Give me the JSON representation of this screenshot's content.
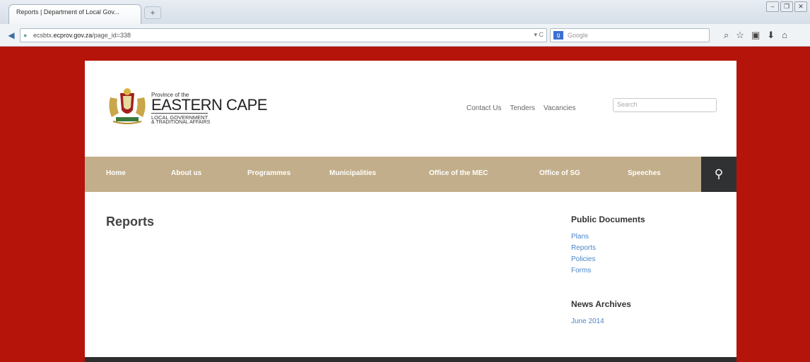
{
  "browser": {
    "tab_title": "Reports | Department of Local Gov...",
    "newtab_label": "+",
    "url_prefix": "ecsbtx.",
    "url_domain": "ecprov.gov.za",
    "url_path": "/page_id=338",
    "search_placeholder": "Google",
    "window_buttons": [
      "–",
      "❐",
      "✕"
    ]
  },
  "site": {
    "logo": {
      "province_of_the": "Province of the",
      "name": "EASTERN CAPE",
      "line1": "LOCAL GOVERNMENT",
      "line2": "& TRADITIONAL AFFAIRS"
    },
    "top_links": [
      "Contact Us",
      "Tenders",
      "Vacancies"
    ],
    "search_placeholder": "Search",
    "nav": [
      "Home",
      "About us",
      "Programmes",
      "Municipalities",
      "Office of the MEC",
      "Office of SG",
      "Speeches"
    ]
  },
  "main": {
    "title": "Reports"
  },
  "sidebar": {
    "public_docs_heading": "Public Documents",
    "public_docs": [
      "Plans",
      "Reports",
      "Policies",
      "Forms"
    ],
    "news_heading": "News Archives",
    "news": [
      "June 2014"
    ]
  },
  "colors": {
    "background": "#b5140a",
    "nav": "#c2ae8a",
    "nav_search": "#2f3133",
    "link": "#4a86c8"
  }
}
